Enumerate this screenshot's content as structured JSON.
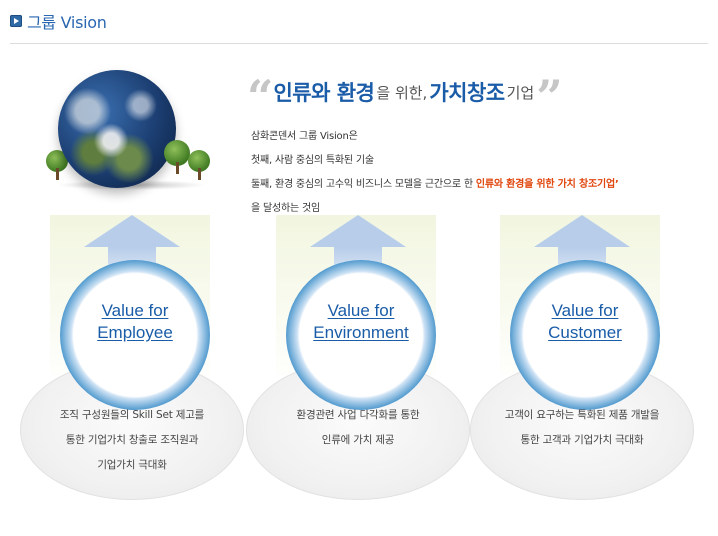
{
  "header": {
    "title": "그룹 Vision"
  },
  "headline": {
    "open_quote": "“",
    "part1": "인류와 환경",
    "part2": "을 위한,",
    "part3": "가치창조",
    "part4": "기업",
    "close_quote": "”"
  },
  "description": {
    "line1": "삼화콘덴서 그룹 Vision은",
    "line2": "첫째, 사람 중심의 특화된 기술",
    "line3_prefix": "둘째, 환경 중심의 고수익 비즈니스 모델을 근간으로 한 ",
    "line3_highlight": "인류와 환경을 위한 가치 창조기업’",
    "line4": "을 달성하는 것임"
  },
  "values": [
    {
      "title_line1": "Value for",
      "title_line2": "Employee",
      "text_line1": "조직 구성원들의 Skill Set 제고를",
      "text_line2": "통한 기업가치 창출로 조직원과",
      "text_line3": "기업가치 극대화"
    },
    {
      "title_line1": "Value for",
      "title_line2": "Environment",
      "text_line1": "환경관련 사업 다각화를 통한",
      "text_line2": "인류에 가치 제공",
      "text_line3": ""
    },
    {
      "title_line1": "Value for",
      "title_line2": "Customer",
      "text_line1": "고객이 요구하는 특화된 제품 개발을",
      "text_line2": "통한 고객과 기업가치 극대화",
      "text_line3": ""
    }
  ],
  "colors": {
    "accent": "#1a5ca8",
    "highlight": "#e0460d",
    "ring": "#2e7ab9"
  }
}
